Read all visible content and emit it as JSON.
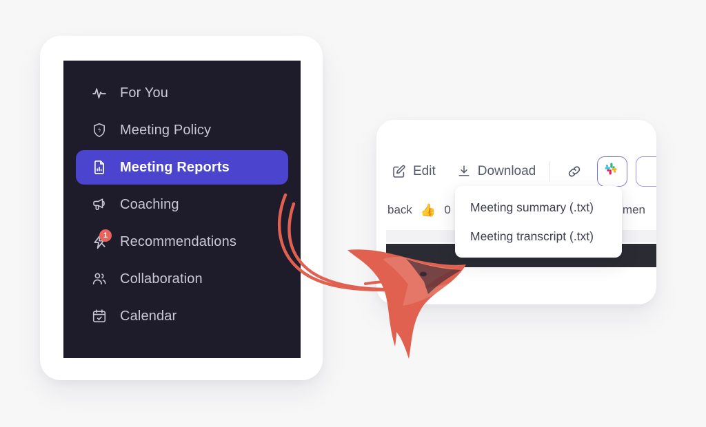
{
  "colors": {
    "page_background": "#f7f7f8",
    "sidebar_background": "#1e1c2b",
    "active_item": "#4b44cf",
    "badge": "#e8635c",
    "annotation_arrow": "#e0614f",
    "slack_border": "#7b74e0"
  },
  "sidebar": {
    "items": [
      {
        "label": "For You",
        "icon": "activity-pulse-icon",
        "active": false,
        "badge": null
      },
      {
        "label": "Meeting Policy",
        "icon": "shield-bolt-icon",
        "active": false,
        "badge": null
      },
      {
        "label": "Meeting Reports",
        "icon": "report-document-icon",
        "active": true,
        "badge": null
      },
      {
        "label": "Coaching",
        "icon": "megaphone-icon",
        "active": false,
        "badge": null
      },
      {
        "label": "Recommendations",
        "icon": "lightning-bolt-icon",
        "active": false,
        "badge": "1"
      },
      {
        "label": "Collaboration",
        "icon": "users-icon",
        "active": false,
        "badge": null
      },
      {
        "label": "Calendar",
        "icon": "calendar-check-icon",
        "active": false,
        "badge": null
      }
    ]
  },
  "panel": {
    "toolbar": {
      "edit_label": "Edit",
      "download_label": "Download",
      "link_icon": "link-chain-icon",
      "slack_icon": "slack-icon"
    },
    "meta_row": {
      "back_label": "back",
      "reaction_emoji": "👍",
      "reaction_count": "0",
      "right_text": "men"
    }
  },
  "dropdown": {
    "items": [
      {
        "label": "Meeting summary (.txt)"
      },
      {
        "label": "Meeting transcript (.txt)"
      }
    ]
  },
  "annotation": {
    "type": "hand-drawn-arrow",
    "from": "Meeting Reports sidebar item",
    "to": "Download dropdown area"
  }
}
